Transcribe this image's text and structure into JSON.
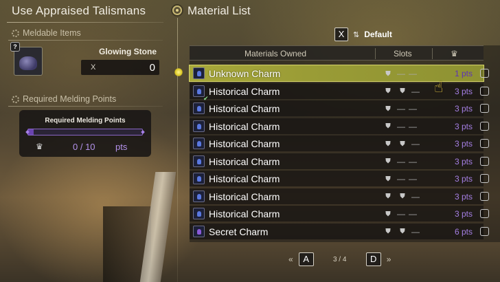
{
  "left_panel": {
    "title": "Use Appraised Talismans",
    "meldable_section": {
      "heading": "Meldable Items",
      "item_name": "Glowing Stone",
      "qty_prefix": "X",
      "qty_value": "0"
    },
    "points_section": {
      "heading": "Required Melding Points",
      "box_title": "Required Melding Points",
      "points_value": "0 / 10",
      "points_unit": "pts",
      "progress_fraction": 0
    }
  },
  "right_panel": {
    "title": "Material List",
    "sort_key": "X",
    "sort_label": "Default",
    "columns": {
      "materials": "Materials Owned",
      "slots": "Slots",
      "points_icon": "melding-points-icon"
    },
    "rows": [
      {
        "name": "Unknown Charm",
        "slots": [
          "slot-icon",
          "—",
          "—"
        ],
        "pts": "1 pts",
        "selected": true,
        "kind": "unknown"
      },
      {
        "name": "Historical Charm",
        "slots": [
          "slot-icon",
          "slot-icon",
          "—"
        ],
        "pts": "3 pts",
        "selected": false,
        "kind": "historical"
      },
      {
        "name": "Historical Charm",
        "slots": [
          "slot-icon",
          "—",
          "—"
        ],
        "pts": "3 pts",
        "selected": false,
        "kind": "historical"
      },
      {
        "name": "Historical Charm",
        "slots": [
          "slot-icon",
          "—",
          "—"
        ],
        "pts": "3 pts",
        "selected": false,
        "kind": "historical"
      },
      {
        "name": "Historical Charm",
        "slots": [
          "slot-icon",
          "slot-icon",
          "—"
        ],
        "pts": "3 pts",
        "selected": false,
        "kind": "historical"
      },
      {
        "name": "Historical Charm",
        "slots": [
          "slot-icon",
          "—",
          "—"
        ],
        "pts": "3 pts",
        "selected": false,
        "kind": "historical"
      },
      {
        "name": "Historical Charm",
        "slots": [
          "slot-icon",
          "—",
          "—"
        ],
        "pts": "3 pts",
        "selected": false,
        "kind": "historical"
      },
      {
        "name": "Historical Charm",
        "slots": [
          "slot-icon",
          "slot-icon",
          "—"
        ],
        "pts": "3 pts",
        "selected": false,
        "kind": "historical"
      },
      {
        "name": "Historical Charm",
        "slots": [
          "slot-icon",
          "—",
          "—"
        ],
        "pts": "3 pts",
        "selected": false,
        "kind": "historical"
      },
      {
        "name": "Secret Charm",
        "slots": [
          "slot-icon",
          "slot-icon",
          "—"
        ],
        "pts": "6 pts",
        "selected": false,
        "kind": "secret"
      }
    ],
    "pager": {
      "prev_key": "A",
      "next_key": "D",
      "page_text": "3 / 4",
      "prev_arrow": "«",
      "next_arrow": "»"
    }
  },
  "colors": {
    "selected_row": "#a8a83a",
    "points_purple": "#a57fe4",
    "progress_bar": "#6a44b0"
  }
}
